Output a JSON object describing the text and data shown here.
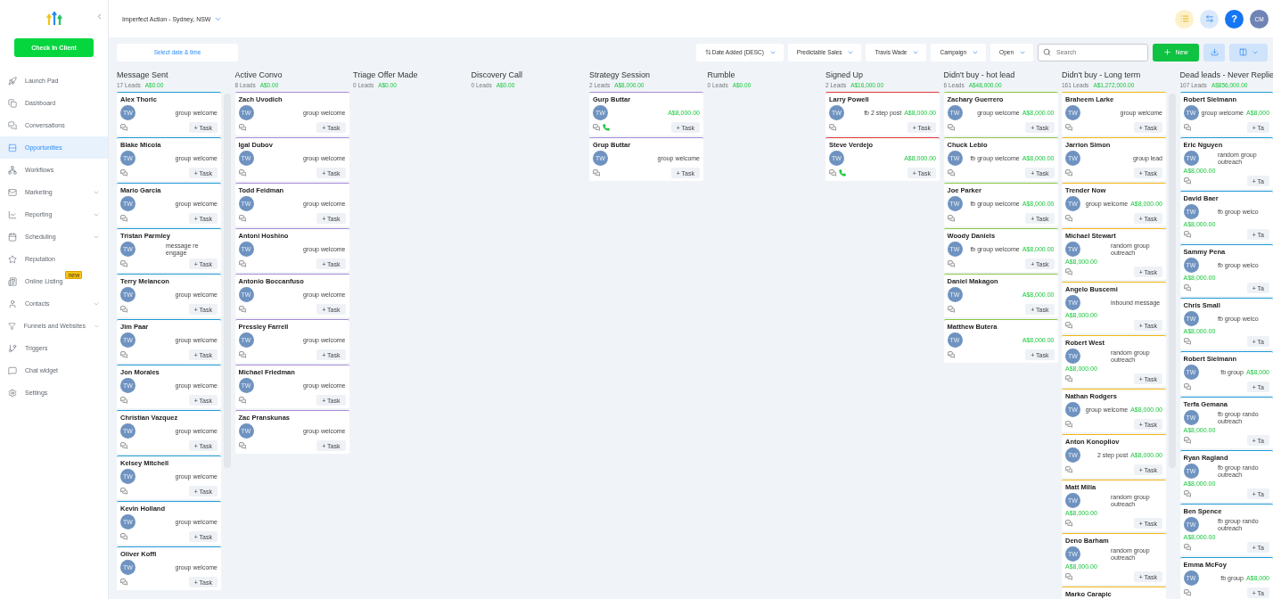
{
  "sidebar": {
    "button": "Check In Client",
    "items": [
      {
        "label": "Launch Pad",
        "selected": false,
        "submenu": false
      },
      {
        "label": "Dashboard",
        "selected": false,
        "submenu": false
      },
      {
        "label": "Conversations",
        "selected": false,
        "submenu": false
      },
      {
        "label": "Opportunities",
        "selected": true,
        "submenu": false
      },
      {
        "label": "Workflows",
        "selected": false,
        "submenu": false
      },
      {
        "label": "Marketing",
        "selected": false,
        "submenu": true
      },
      {
        "label": "Reporting",
        "selected": false,
        "submenu": true
      },
      {
        "label": "Scheduling",
        "selected": false,
        "submenu": true
      },
      {
        "label": "Reputation",
        "selected": false,
        "submenu": false
      },
      {
        "label": "Online Listing",
        "selected": false,
        "submenu": false,
        "badge": "new"
      },
      {
        "label": "Contacts",
        "selected": false,
        "submenu": true
      },
      {
        "label": "Funnels and Websites",
        "selected": false,
        "submenu": true
      },
      {
        "label": "Triggers",
        "selected": false,
        "submenu": false
      },
      {
        "label": "Chat widget",
        "selected": false,
        "submenu": false
      },
      {
        "label": "Settings",
        "selected": false,
        "submenu": false
      }
    ]
  },
  "topbar": {
    "location": "Imperfect Action - Sydney, NSW",
    "help": "?",
    "user": "CM"
  },
  "toolbar": {
    "date_button": "Select date & time",
    "filters": [
      "Date Added (DESC)",
      "Predictable Sales",
      "Travis Wade",
      "Campaign",
      "Open"
    ],
    "search": {
      "placeholder": "Search"
    },
    "new_button": "New"
  },
  "columns": [
    {
      "title": "Message Sent",
      "leads": "17 Leads",
      "total": "A$0.00",
      "color": "#1f9bd6",
      "cards": [
        {
          "name": "Alex Thoric",
          "avatar": "TW",
          "note": "group welcome",
          "kind": "inline",
          "phone": false,
          "task": "+ Task"
        },
        {
          "name": "Blake Micola",
          "avatar": "TW",
          "note": "group welcome",
          "kind": "inline",
          "phone": false,
          "task": "+ Task"
        },
        {
          "name": "Mario Garcia",
          "avatar": "TW",
          "note": "group welcome",
          "kind": "inline",
          "phone": false,
          "task": "+ Task"
        },
        {
          "name": "Tristan Parmley",
          "avatar": "TW",
          "note": "message re engage",
          "kind": "stacked",
          "phone": false,
          "task": "+ Task"
        },
        {
          "name": "Terry Melancon",
          "avatar": "TW",
          "note": "group welcome",
          "kind": "inline",
          "phone": false,
          "task": "+ Task"
        },
        {
          "name": "Jim Paar",
          "avatar": "TW",
          "note": "group welcome",
          "kind": "inline",
          "phone": false,
          "task": "+ Task"
        },
        {
          "name": "Jon Morales",
          "avatar": "TW",
          "note": "group welcome",
          "kind": "inline",
          "phone": false,
          "task": "+ Task"
        },
        {
          "name": "Christian Vazquez",
          "avatar": "TW",
          "note": "group welcome",
          "kind": "inline",
          "phone": false,
          "task": "+ Task"
        },
        {
          "name": "Kelsey Mitchell",
          "avatar": "TW",
          "note": "group welcome",
          "kind": "inline",
          "phone": false,
          "task": "+ Task"
        },
        {
          "name": "Kevin Holland",
          "avatar": "TW",
          "note": "group welcome",
          "kind": "inline",
          "phone": false,
          "task": "+ Task"
        },
        {
          "name": "Oliver Koffi",
          "avatar": "TW",
          "note": "group welcome",
          "kind": "inline",
          "phone": false,
          "task": "+ Task"
        }
      ]
    },
    {
      "title": "Active Convo",
      "leads": "8 Leads",
      "total": "A$0.00",
      "color": "#a88bd6",
      "cards": [
        {
          "name": "Zach Uvodich",
          "avatar": "TW",
          "note": "group welcome",
          "kind": "inline",
          "phone": false,
          "task": "+ Task"
        },
        {
          "name": "Igal Dubov",
          "avatar": "TW",
          "note": "group welcome",
          "kind": "inline",
          "phone": false,
          "task": "+ Task"
        },
        {
          "name": "Todd Feidman",
          "avatar": "TW",
          "note": "group welcome",
          "kind": "inline",
          "phone": false,
          "task": "+ Task"
        },
        {
          "name": "Antoni Hoshino",
          "avatar": "TW",
          "note": "group welcome",
          "kind": "inline",
          "phone": false,
          "task": "+ Task"
        },
        {
          "name": "Antonio Boccanfuso",
          "avatar": "TW",
          "note": "group welcome",
          "kind": "inline",
          "phone": false,
          "task": "+ Task"
        },
        {
          "name": "Pressley Farrell",
          "avatar": "TW",
          "note": "group welcome",
          "kind": "inline",
          "phone": false,
          "task": "+ Task"
        },
        {
          "name": "Michael Friedman",
          "avatar": "TW",
          "note": "group welcome",
          "kind": "inline",
          "phone": false,
          "task": "+ Task"
        },
        {
          "name": "Zac Pranskunas",
          "avatar": "TW",
          "note": "group welcome",
          "kind": "inline",
          "phone": false,
          "task": "+ Task"
        }
      ]
    },
    {
      "title": "Triage Offer Made",
      "leads": "0 Leads",
      "total": "A$0.00"
    },
    {
      "title": "Discovery Call",
      "leads": "0 Leads",
      "total": "A$0.00"
    },
    {
      "title": "Strategy Session",
      "leads": "2 Leads",
      "total": "A$8,000.00",
      "color": "#a88bd6",
      "cards": [
        {
          "name": "Gurp Buttar",
          "avatar": "TW",
          "amount": "A$8,000.00",
          "kind": "inline",
          "phone": true,
          "task": "+ Task"
        },
        {
          "name": "Grup Buttar",
          "avatar": "TW",
          "note": "group welcome",
          "kind": "inline",
          "phone": false,
          "task": "+ Task"
        }
      ]
    },
    {
      "title": "Rumble",
      "leads": "0 Leads",
      "total": "A$0.00"
    },
    {
      "title": "Signed Up",
      "leads": "2 Leads",
      "total": "A$16,000.00",
      "color": "#e2343a",
      "cards": [
        {
          "name": "Larry Powell",
          "avatar": "TW",
          "note": "fb 2 step post",
          "amount": "A$8,000.00",
          "kind": "inline",
          "phone": false,
          "task": "+ Task"
        },
        {
          "name": "Steve Verdejo",
          "avatar": "TW",
          "amount": "A$8,000.00",
          "kind": "inline",
          "phone": true,
          "task": "+ Task"
        }
      ]
    },
    {
      "title": "Didn't buy - hot lead",
      "leads": "6 Leads",
      "total": "A$48,000.00",
      "color": "#8cc63e",
      "cards": [
        {
          "name": "Zachary Guerrero",
          "avatar": "TW",
          "note": "group welcome",
          "amount": "A$8,000.00",
          "kind": "inline",
          "phone": false,
          "task": "+ Task"
        },
        {
          "name": "Chuck Leblo",
          "avatar": "TW",
          "note": "fb group welcome",
          "amount": "A$8,000.00",
          "kind": "inline",
          "phone": false,
          "task": "+ Task"
        },
        {
          "name": "Joe Parker",
          "avatar": "TW",
          "note": "fb group welcome",
          "amount": "A$8,000.00",
          "kind": "inline",
          "phone": false,
          "task": "+ Task"
        },
        {
          "name": "Woody Daniels",
          "avatar": "TW",
          "note": "fb group welcome",
          "amount": "A$8,000.00",
          "kind": "inline",
          "phone": false,
          "task": "+ Task"
        },
        {
          "name": "Daniel Makagon",
          "avatar": "TW",
          "amount": "A$8,000.00",
          "kind": "inline",
          "phone": false,
          "task": "+ Task"
        },
        {
          "name": "Matthew Butera",
          "avatar": "TW",
          "amount": "A$8,000.00",
          "kind": "inline",
          "phone": false,
          "task": "+ Task"
        }
      ]
    },
    {
      "title": "Didn't buy - Long term",
      "leads": "161 Leads",
      "total": "A$1,272,000.00",
      "color": "#f3b50f",
      "cards": [
        {
          "name": "Braheem Larke",
          "avatar": "TW",
          "note": "group welcome",
          "kind": "inline",
          "phone": false,
          "task": "+ Task"
        },
        {
          "name": "Jarrion Simon",
          "avatar": "TW",
          "note": "group lead",
          "kind": "inline",
          "phone": false,
          "task": "+ Task"
        },
        {
          "name": "Trender Now",
          "avatar": "TW",
          "note": "group welcome",
          "amount": "A$8,000.00",
          "kind": "inline",
          "phone": false,
          "task": "+ Task"
        },
        {
          "name": "Michael Stewart",
          "avatar": "TW",
          "note": "random group outreach",
          "amount": "A$8,000.00",
          "kind": "stacked",
          "phone": false,
          "task": "+ Task"
        },
        {
          "name": "Angelo Buscemi",
          "avatar": "TW",
          "note": "inbound message",
          "amount": "A$8,000.00",
          "kind": "stacked",
          "phone": false,
          "task": "+ Task"
        },
        {
          "name": "Robert West",
          "avatar": "TW",
          "note": "random group outreach",
          "amount": "A$8,000.00",
          "kind": "stacked",
          "phone": false,
          "task": "+ Task"
        },
        {
          "name": "Nathan Rodgers",
          "avatar": "TW",
          "note": "group welcome",
          "amount": "A$8,000.00",
          "kind": "inline",
          "phone": false,
          "task": "+ Task"
        },
        {
          "name": "Anton Konopliov",
          "avatar": "TW",
          "note": "2 step post",
          "amount": "A$8,000.00",
          "kind": "inline",
          "phone": false,
          "task": "+ Task"
        },
        {
          "name": "Matt Milia",
          "avatar": "TW",
          "note": "random group outreach",
          "amount": "A$8,000.00",
          "kind": "stacked",
          "phone": false,
          "task": "+ Task"
        },
        {
          "name": "Deno Barham",
          "avatar": "TW",
          "note": "random group outreach",
          "amount": "A$8,000.00",
          "kind": "stacked",
          "phone": false,
          "task": "+ Task"
        },
        {
          "name": "Marko Carapic",
          "kind": "inline",
          "phone": false
        }
      ]
    },
    {
      "title": "Dead leads - Never Replie",
      "leads": "107 Leads",
      "total": "A$856,000.00",
      "color": "#1f9bd6",
      "cards": [
        {
          "name": "Robert Sielmann",
          "avatar": "TW",
          "note": "group welcome",
          "amount": "A$8,000",
          "kind": "inline",
          "phone": false,
          "task": "+ Ta"
        },
        {
          "name": "Eric Nguyen",
          "avatar": "TW",
          "note": "random group outreach",
          "amount": "A$8,000.00",
          "kind": "stacked",
          "phone": false,
          "task": "+ Ta"
        },
        {
          "name": "David Baer",
          "avatar": "TW",
          "note": "fb group welco",
          "amount": "A$8,000.00",
          "kind": "stacked",
          "phone": false,
          "task": "+ Ta"
        },
        {
          "name": "Sammy Pena",
          "avatar": "TW",
          "note": "fb group welco",
          "amount": "A$8,000.00",
          "kind": "stacked",
          "phone": false,
          "task": "+ Ta"
        },
        {
          "name": "Chris Small",
          "avatar": "TW",
          "note": "fb group welco",
          "amount": "A$8,000.00",
          "kind": "stacked",
          "phone": false,
          "task": "+ Ta"
        },
        {
          "name": "Robert Sielmann",
          "avatar": "TW",
          "note": "fb group",
          "amount": "A$8,000",
          "kind": "inline",
          "phone": false,
          "task": "+ Ta"
        },
        {
          "name": "Terfa Gemana",
          "avatar": "TW",
          "note": "fb group rando outreach",
          "amount": "A$8,000.00",
          "kind": "stacked",
          "phone": false,
          "task": "+ Ta"
        },
        {
          "name": "Ryan Ragland",
          "avatar": "TW",
          "note": "fb group rando outreach",
          "amount": "A$8,000.00",
          "kind": "stacked",
          "phone": false,
          "task": "+ Ta"
        },
        {
          "name": "Ben Spence",
          "avatar": "TW",
          "note": "fb group rando outreach",
          "amount": "A$8,000.00",
          "kind": "stacked",
          "phone": false,
          "task": "+ Ta"
        },
        {
          "name": "Emma McFoy",
          "avatar": "TW",
          "note": "fb group",
          "amount": "A$8,000",
          "kind": "inline",
          "phone": false,
          "task": "+ Ta"
        }
      ]
    }
  ]
}
